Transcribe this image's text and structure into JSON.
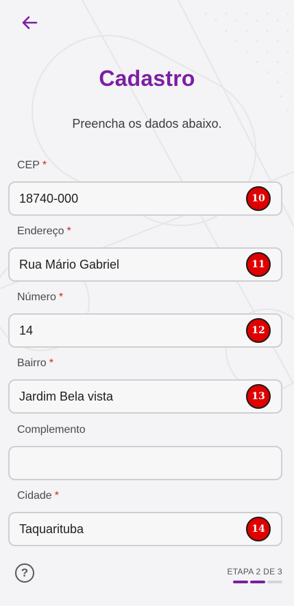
{
  "header": {
    "title": "Cadastro",
    "subtitle": "Preencha os dados abaixo."
  },
  "required_marker": "*",
  "fields": [
    {
      "label": "CEP",
      "required": true,
      "value": "18740-000",
      "badge": "10"
    },
    {
      "label": "Endereço",
      "required": true,
      "value": "Rua Mário Gabriel",
      "badge": "11"
    },
    {
      "label": "Número",
      "required": true,
      "value": "14",
      "badge": "12"
    },
    {
      "label": "Bairro",
      "required": true,
      "value": "Jardim Bela vista",
      "badge": "13"
    },
    {
      "label": "Complemento",
      "required": false,
      "value": "",
      "badge": ""
    },
    {
      "label": "Cidade",
      "required": true,
      "value": "Taquarituba",
      "badge": "14"
    }
  ],
  "footer": {
    "help_icon": "?",
    "step_label": "ETAPA 2 DE 3",
    "steps_total": 3,
    "steps_completed": 2
  },
  "colors": {
    "accent": "#7b1fa2",
    "required": "#c62828",
    "badge": "#e00000",
    "background": "#f4f3f5"
  },
  "icons": {
    "back": "arrow-left-icon",
    "help": "question-circle-icon"
  }
}
